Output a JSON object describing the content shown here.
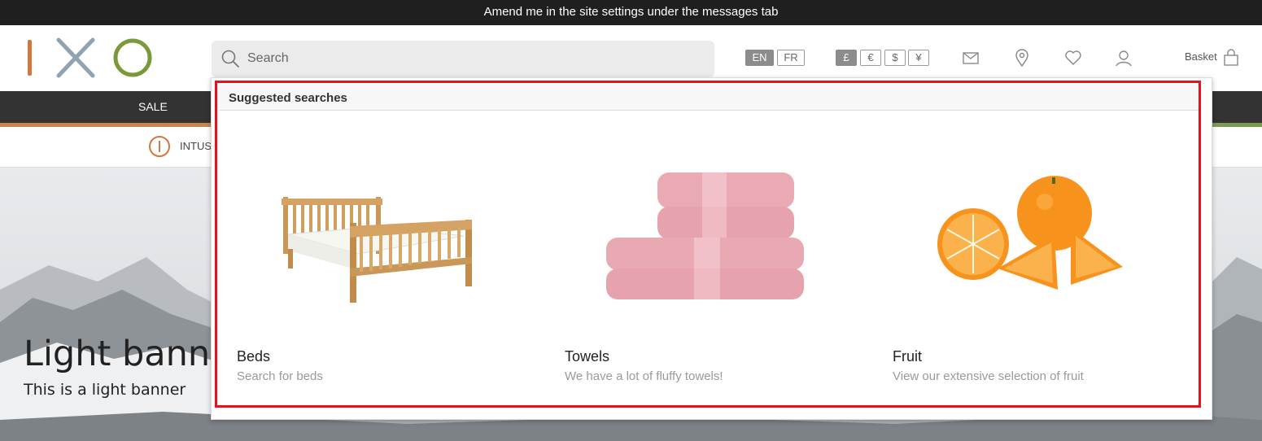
{
  "announcement": "Amend me in the site settings under the messages tab",
  "search": {
    "placeholder": "Search"
  },
  "languages": [
    {
      "label": "EN",
      "active": true
    },
    {
      "label": "FR",
      "active": false
    }
  ],
  "currencies": [
    {
      "label": "£",
      "active": true
    },
    {
      "label": "€",
      "active": false
    },
    {
      "label": "$",
      "active": false
    },
    {
      "label": "¥",
      "active": false
    }
  ],
  "header_icons": [
    "mail-icon",
    "location-pin-icon",
    "heart-icon",
    "user-icon",
    "basket-icon"
  ],
  "basket": {
    "label": "Basket"
  },
  "nav": {
    "sale": "SALE"
  },
  "subnav": {
    "label": "INTUS"
  },
  "banner": {
    "title": "Light banner",
    "subtitle": "This is a light banner"
  },
  "suggestions": {
    "header": "Suggested searches",
    "items": [
      {
        "name": "Beds",
        "description": "Search for beds",
        "image": "wooden-bed-image"
      },
      {
        "name": "Towels",
        "description": "We have a lot of fluffy towels!",
        "image": "pink-towels-image"
      },
      {
        "name": "Fruit",
        "description": "View our extensive selection of fruit",
        "image": "oranges-image"
      }
    ]
  },
  "colors": {
    "highlight": "#e8101a",
    "logo_orange": "#d2783f",
    "logo_blue": "#8fa3b0",
    "logo_green": "#7a9a3a",
    "nav_bg": "#333333"
  }
}
